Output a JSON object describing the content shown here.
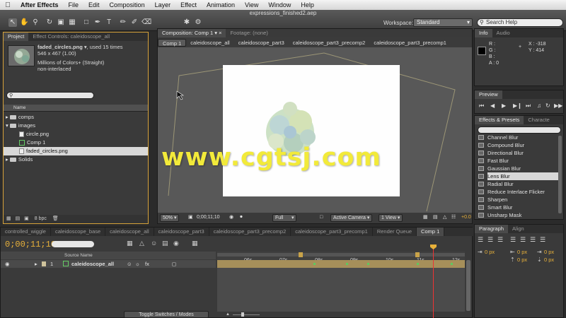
{
  "menubar": {
    "apple": "",
    "app": "After Effects",
    "items": [
      "File",
      "Edit",
      "Composition",
      "Layer",
      "Effect",
      "Animation",
      "View",
      "Window",
      "Help"
    ]
  },
  "window": {
    "title": "expressions_finished2.aep"
  },
  "toolbar": {
    "workspace_label": "Workspace:",
    "workspace_value": "Standard",
    "search_help": "Search Help"
  },
  "project_panel": {
    "tabs": [
      "Project",
      "Effect Controls: caleidoscope_all"
    ],
    "item_name": "faded_circles.png",
    "item_used": ", used 15 times",
    "item_size": "546 x 467 (1.00)",
    "item_color": "Millions of Colors+ (Straight)",
    "item_interlace": "non-interlaced",
    "column_name": "Name",
    "rows": [
      {
        "name": "comps",
        "type": "folder"
      },
      {
        "name": "images",
        "type": "folder"
      },
      {
        "name": "circle.png",
        "type": "file"
      },
      {
        "name": "Comp 1",
        "type": "comp"
      },
      {
        "name": "faded_circles.png",
        "type": "file"
      },
      {
        "name": "Solids",
        "type": "folder"
      }
    ],
    "bpc": "8 bpc"
  },
  "comp_panel": {
    "tabs": [
      "Composition: Comp 1",
      "Footage: (none)"
    ],
    "breadcrumbs": [
      "Comp 1",
      "caleidoscope_all",
      "caleidoscope_part3",
      "caleidoscope_part3_precomp2",
      "caleidoscope_part3_precomp1"
    ],
    "zoom": "50%",
    "timecode": "0;00;11;10",
    "resolution": "Full",
    "camera": "Active Camera",
    "views": "1 View",
    "offset": "+0.0"
  },
  "watermark": "www.cgtsj.com",
  "info_panel": {
    "tabs": [
      "Info",
      "Audio"
    ],
    "r": "R :",
    "g": "G :",
    "b": "B :",
    "a": "A : 0",
    "x": "X : -318",
    "y": "Y : 414"
  },
  "preview_panel": {
    "tab": "Preview"
  },
  "effects_panel": {
    "tabs": [
      "Effects & Presets",
      "Characte"
    ],
    "items": [
      "Channel Blur",
      "Compound Blur",
      "Directional Blur",
      "Fast Blur",
      "Gaussian Blur",
      "Lens Blur",
      "Radial Blur",
      "Reduce Interlace Flicker",
      "Sharpen",
      "Smart Blur",
      "Unsharp Mask"
    ],
    "selected": "Lens Blur"
  },
  "timeline": {
    "tabs": [
      "controlled_wiggle",
      "caleidoscope_base",
      "caleidoscope_all",
      "caleidoscope_part3",
      "caleidoscope_part3_precomp2",
      "caleidoscope_part3_precomp1",
      "Render Queue",
      "Comp 1"
    ],
    "active_tab": "Comp 1",
    "timecode": "0;00;11;10",
    "source_name_header": "Source Name",
    "layer_number": "1",
    "layer_name": "caleidoscope_all",
    "ruler": [
      "06s",
      "07s",
      "08s",
      "09s",
      "10s",
      "11s",
      "12s"
    ],
    "toggle_button": "Toggle Switches / Modes"
  },
  "paragraph_panel": {
    "tabs": [
      "Paragraph",
      "Align"
    ],
    "values": [
      "0 px",
      "0 px",
      "0 px",
      "0 px",
      "0 px"
    ]
  }
}
